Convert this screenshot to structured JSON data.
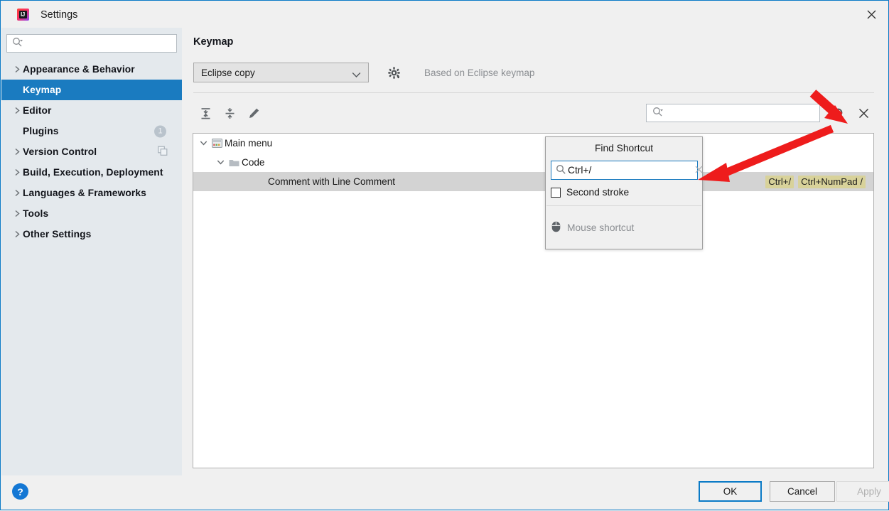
{
  "window": {
    "title": "Settings",
    "logo_icon": "intellij-idea-logo",
    "close_icon": "close-icon",
    "accent_color": "#1a7bc0",
    "titlebar_border_color": "#0a7ac6"
  },
  "sidebar": {
    "search": {
      "value": "",
      "placeholder": "",
      "icon": "search-icon"
    },
    "items": [
      {
        "label": "Appearance & Behavior",
        "expandable": true,
        "selected": false
      },
      {
        "label": "Keymap",
        "expandable": false,
        "selected": true
      },
      {
        "label": "Editor",
        "expandable": true,
        "selected": false
      },
      {
        "label": "Plugins",
        "expandable": false,
        "selected": false,
        "badge": "1"
      },
      {
        "label": "Version Control",
        "expandable": true,
        "selected": false,
        "trailing_icon": "copy-icon"
      },
      {
        "label": "Build, Execution, Deployment",
        "expandable": true,
        "selected": false
      },
      {
        "label": "Languages & Frameworks",
        "expandable": true,
        "selected": false
      },
      {
        "label": "Tools",
        "expandable": true,
        "selected": false
      },
      {
        "label": "Other Settings",
        "expandable": true,
        "selected": false
      }
    ]
  },
  "main": {
    "title": "Keymap",
    "scheme": {
      "selected": "Eclipse copy",
      "dropdown_icon": "chevron-down-icon",
      "gear_icon": "gear-icon",
      "based_on": "Based on Eclipse keymap"
    },
    "toolbar": [
      {
        "name": "expand-all-button",
        "icon": "expand-all-icon"
      },
      {
        "name": "collapse-all-button",
        "icon": "collapse-all-icon"
      },
      {
        "name": "edit-shortcut-button",
        "icon": "pencil-icon"
      }
    ],
    "tree_search": {
      "value": "",
      "placeholder": "",
      "icon": "search-icon"
    },
    "find_by_shortcut_icon": "find-by-shortcut-icon",
    "close_search_icon": "close-icon",
    "tree": [
      {
        "label": "Main menu",
        "level": 0,
        "expanded": true,
        "icon": "main-menu-icon",
        "selected": false,
        "shortcuts": []
      },
      {
        "label": "Code",
        "level": 1,
        "expanded": true,
        "icon": "folder-icon",
        "selected": false,
        "shortcuts": []
      },
      {
        "label": "Comment with Line Comment",
        "level": 2,
        "expanded": null,
        "icon": "",
        "selected": true,
        "shortcuts": [
          "Ctrl+/",
          "Ctrl+NumPad /"
        ]
      }
    ],
    "shortcut_badge_color": "#d8d29a"
  },
  "popup": {
    "title": "Find Shortcut",
    "input": {
      "value": "Ctrl+/",
      "placeholder": "",
      "icon": "search-icon",
      "clear_icon": "clear-icon"
    },
    "second_stroke": {
      "label": "Second stroke",
      "checked": false
    },
    "mouse_shortcut": {
      "label": "Mouse shortcut",
      "icon": "mouse-icon",
      "disabled": true
    }
  },
  "bottom": {
    "help_icon": "help-icon",
    "help_label": "?",
    "buttons": [
      {
        "label": "OK",
        "name": "ok-button",
        "default": true,
        "disabled": false
      },
      {
        "label": "Cancel",
        "name": "cancel-button",
        "default": false,
        "disabled": false
      },
      {
        "label": "Apply",
        "name": "apply-button",
        "default": false,
        "disabled": true
      }
    ]
  },
  "annotations": {
    "color": "#ee1c1c",
    "arrows": [
      {
        "name": "arrow-to-find-by-shortcut-icon",
        "points_to": "find-by-shortcut-icon"
      },
      {
        "name": "arrow-to-find-shortcut-input",
        "points_to": "popup-search-input"
      }
    ]
  }
}
